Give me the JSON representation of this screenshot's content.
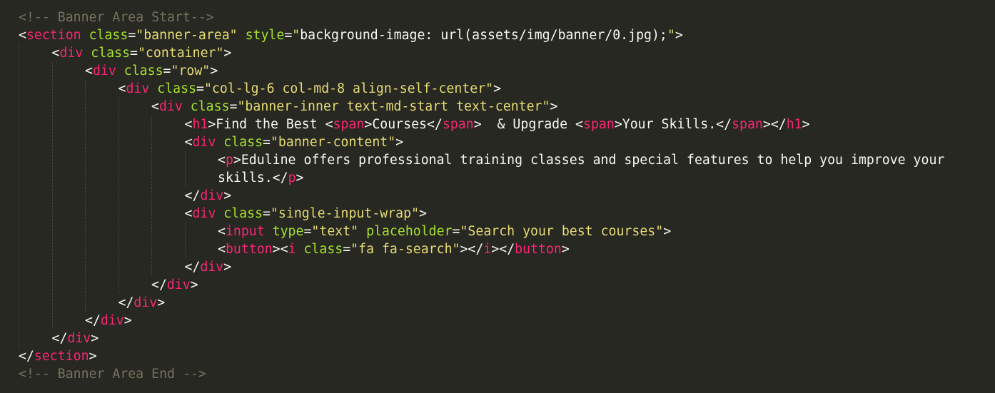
{
  "editor": {
    "language": "html",
    "theme": {
      "background": "#272822",
      "text": "#f8f8f2",
      "comment": "#75715e",
      "tag": "#f92672",
      "attribute": "#a6e22e",
      "string": "#e6db74"
    },
    "lines": [
      {
        "indent": 0,
        "tokens": [
          {
            "t": "c",
            "v": "<!-- Banner Area Start-->"
          }
        ]
      },
      {
        "indent": 0,
        "tokens": [
          {
            "t": "p",
            "v": "<"
          },
          {
            "t": "g",
            "v": "section"
          },
          {
            "t": "p",
            "v": " "
          },
          {
            "t": "a",
            "v": "class"
          },
          {
            "t": "p",
            "v": "="
          },
          {
            "t": "s",
            "v": "\"banner-area\""
          },
          {
            "t": "p",
            "v": " "
          },
          {
            "t": "a",
            "v": "style"
          },
          {
            "t": "p",
            "v": "="
          },
          {
            "t": "s",
            "v": "\""
          },
          {
            "t": "p",
            "v": "background-image: url(assets/img/banner/0.jpg);"
          },
          {
            "t": "s",
            "v": "\""
          },
          {
            "t": "p",
            "v": ">"
          }
        ]
      },
      {
        "indent": 1,
        "tokens": [
          {
            "t": "p",
            "v": "<"
          },
          {
            "t": "g",
            "v": "div"
          },
          {
            "t": "p",
            "v": " "
          },
          {
            "t": "a",
            "v": "class"
          },
          {
            "t": "p",
            "v": "="
          },
          {
            "t": "s",
            "v": "\"container\""
          },
          {
            "t": "p",
            "v": ">"
          }
        ]
      },
      {
        "indent": 2,
        "tokens": [
          {
            "t": "p",
            "v": "<"
          },
          {
            "t": "g",
            "v": "div"
          },
          {
            "t": "p",
            "v": " "
          },
          {
            "t": "a",
            "v": "class"
          },
          {
            "t": "p",
            "v": "="
          },
          {
            "t": "s",
            "v": "\"row\""
          },
          {
            "t": "p",
            "v": ">"
          }
        ]
      },
      {
        "indent": 3,
        "tokens": [
          {
            "t": "p",
            "v": "<"
          },
          {
            "t": "g",
            "v": "div"
          },
          {
            "t": "p",
            "v": " "
          },
          {
            "t": "a",
            "v": "class"
          },
          {
            "t": "p",
            "v": "="
          },
          {
            "t": "s",
            "v": "\"col-lg-6 col-md-8 align-self-center\""
          },
          {
            "t": "p",
            "v": ">"
          }
        ]
      },
      {
        "indent": 4,
        "tokens": [
          {
            "t": "p",
            "v": "<"
          },
          {
            "t": "g",
            "v": "div"
          },
          {
            "t": "p",
            "v": " "
          },
          {
            "t": "a",
            "v": "class"
          },
          {
            "t": "p",
            "v": "="
          },
          {
            "t": "s",
            "v": "\"banner-inner text-md-start text-center\""
          },
          {
            "t": "p",
            "v": ">"
          }
        ]
      },
      {
        "indent": 5,
        "tokens": [
          {
            "t": "p",
            "v": "<"
          },
          {
            "t": "g",
            "v": "h1"
          },
          {
            "t": "p",
            "v": ">Find the Best <"
          },
          {
            "t": "g",
            "v": "span"
          },
          {
            "t": "p",
            "v": ">Courses</"
          },
          {
            "t": "g",
            "v": "span"
          },
          {
            "t": "p",
            "v": ">  & Upgrade <"
          },
          {
            "t": "g",
            "v": "span"
          },
          {
            "t": "p",
            "v": ">Your Skills.</"
          },
          {
            "t": "g",
            "v": "span"
          },
          {
            "t": "p",
            "v": "></"
          },
          {
            "t": "g",
            "v": "h1"
          },
          {
            "t": "p",
            "v": ">"
          }
        ]
      },
      {
        "indent": 5,
        "tokens": [
          {
            "t": "p",
            "v": "<"
          },
          {
            "t": "g",
            "v": "div"
          },
          {
            "t": "p",
            "v": " "
          },
          {
            "t": "a",
            "v": "class"
          },
          {
            "t": "p",
            "v": "="
          },
          {
            "t": "s",
            "v": "\"banner-content\""
          },
          {
            "t": "p",
            "v": ">"
          }
        ]
      },
      {
        "indent": 6,
        "tokens": [
          {
            "t": "p",
            "v": "<"
          },
          {
            "t": "g",
            "v": "p"
          },
          {
            "t": "p",
            "v": ">Eduline offers professional training classes and special features to help you improve your"
          }
        ]
      },
      {
        "indent": 6,
        "tokens": [
          {
            "t": "p",
            "v": "skills.</"
          },
          {
            "t": "g",
            "v": "p"
          },
          {
            "t": "p",
            "v": ">"
          }
        ]
      },
      {
        "indent": 5,
        "tokens": [
          {
            "t": "p",
            "v": "</"
          },
          {
            "t": "g",
            "v": "div"
          },
          {
            "t": "p",
            "v": ">"
          }
        ]
      },
      {
        "indent": 5,
        "tokens": [
          {
            "t": "p",
            "v": "<"
          },
          {
            "t": "g",
            "v": "div"
          },
          {
            "t": "p",
            "v": " "
          },
          {
            "t": "a",
            "v": "class"
          },
          {
            "t": "p",
            "v": "="
          },
          {
            "t": "s",
            "v": "\"single-input-wrap\""
          },
          {
            "t": "p",
            "v": ">"
          }
        ]
      },
      {
        "indent": 6,
        "tokens": [
          {
            "t": "p",
            "v": "<"
          },
          {
            "t": "g",
            "v": "input"
          },
          {
            "t": "p",
            "v": " "
          },
          {
            "t": "a",
            "v": "type"
          },
          {
            "t": "p",
            "v": "="
          },
          {
            "t": "s",
            "v": "\"text\""
          },
          {
            "t": "p",
            "v": " "
          },
          {
            "t": "a",
            "v": "placeholder"
          },
          {
            "t": "p",
            "v": "="
          },
          {
            "t": "s",
            "v": "\"Search your best courses\""
          },
          {
            "t": "p",
            "v": ">"
          }
        ]
      },
      {
        "indent": 6,
        "tokens": [
          {
            "t": "p",
            "v": "<"
          },
          {
            "t": "g",
            "v": "button"
          },
          {
            "t": "p",
            "v": "><"
          },
          {
            "t": "g",
            "v": "i"
          },
          {
            "t": "p",
            "v": " "
          },
          {
            "t": "a",
            "v": "class"
          },
          {
            "t": "p",
            "v": "="
          },
          {
            "t": "s",
            "v": "\"fa fa-search\""
          },
          {
            "t": "p",
            "v": "></"
          },
          {
            "t": "g",
            "v": "i"
          },
          {
            "t": "p",
            "v": "></"
          },
          {
            "t": "g",
            "v": "button"
          },
          {
            "t": "p",
            "v": ">"
          }
        ]
      },
      {
        "indent": 5,
        "tokens": [
          {
            "t": "p",
            "v": "</"
          },
          {
            "t": "g",
            "v": "div"
          },
          {
            "t": "p",
            "v": ">"
          }
        ]
      },
      {
        "indent": 4,
        "tokens": [
          {
            "t": "p",
            "v": "</"
          },
          {
            "t": "g",
            "v": "div"
          },
          {
            "t": "p",
            "v": ">"
          }
        ]
      },
      {
        "indent": 3,
        "tokens": [
          {
            "t": "p",
            "v": "</"
          },
          {
            "t": "g",
            "v": "div"
          },
          {
            "t": "p",
            "v": ">"
          }
        ]
      },
      {
        "indent": 2,
        "tokens": [
          {
            "t": "p",
            "v": "</"
          },
          {
            "t": "g",
            "v": "div"
          },
          {
            "t": "p",
            "v": ">"
          }
        ]
      },
      {
        "indent": 1,
        "tokens": [
          {
            "t": "p",
            "v": "</"
          },
          {
            "t": "g",
            "v": "div"
          },
          {
            "t": "p",
            "v": ">"
          }
        ]
      },
      {
        "indent": 0,
        "tokens": [
          {
            "t": "p",
            "v": "</"
          },
          {
            "t": "g",
            "v": "section"
          },
          {
            "t": "p",
            "v": ">"
          }
        ]
      },
      {
        "indent": 0,
        "tokens": [
          {
            "t": "c",
            "v": "<!-- Banner Area End -->"
          }
        ]
      }
    ]
  }
}
